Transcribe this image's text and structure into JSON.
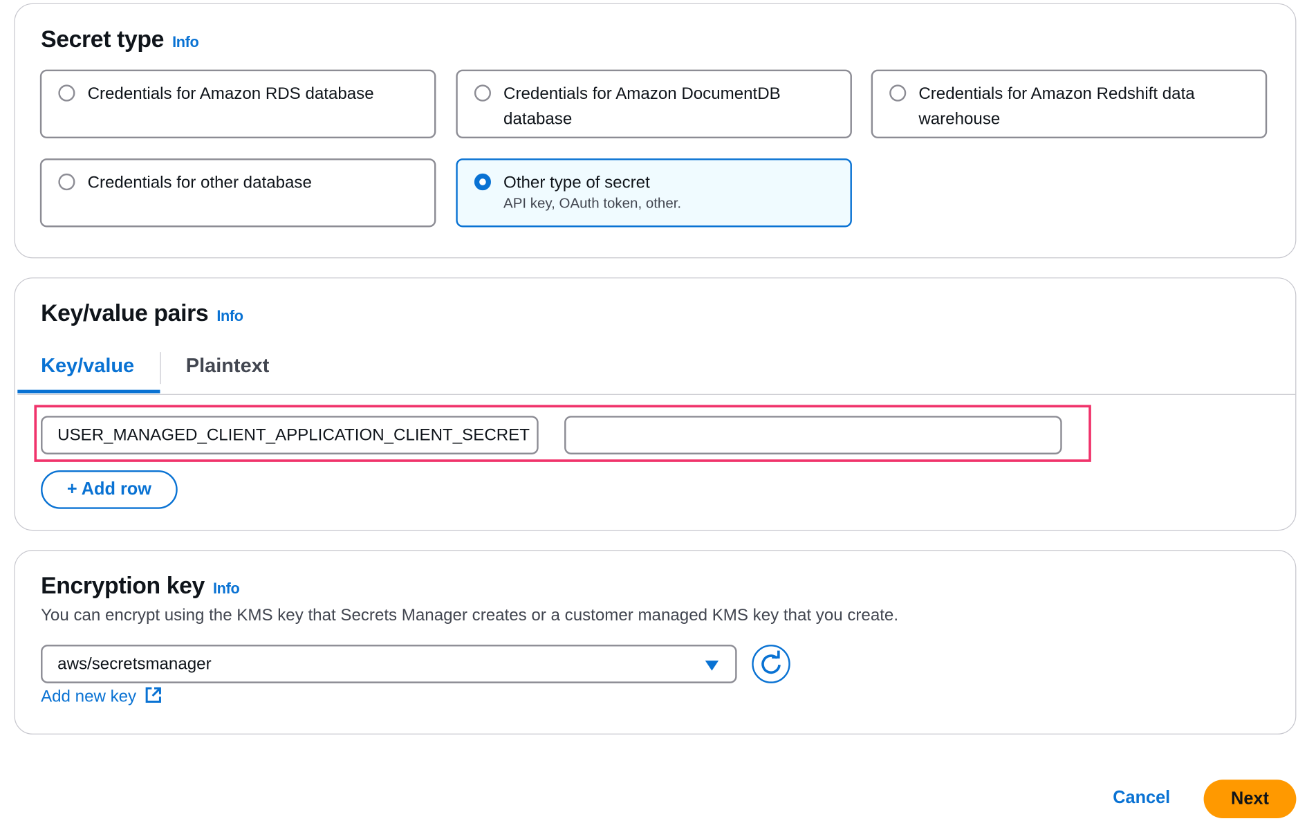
{
  "secret_type": {
    "title": "Secret type",
    "info": "Info",
    "options": [
      {
        "label": "Credentials for Amazon RDS database",
        "selected": false
      },
      {
        "label": "Credentials for Amazon DocumentDB database",
        "selected": false
      },
      {
        "label": "Credentials for Amazon Redshift data warehouse",
        "selected": false
      },
      {
        "label": "Credentials for other database",
        "selected": false
      },
      {
        "label": "Other type of secret",
        "description": "API key, OAuth token, other.",
        "selected": true
      }
    ]
  },
  "kv": {
    "title": "Key/value pairs",
    "info": "Info",
    "tabs": [
      {
        "label": "Key/value",
        "active": true
      },
      {
        "label": "Plaintext",
        "active": false
      }
    ],
    "rows": [
      {
        "key": "USER_MANAGED_CLIENT_APPLICATION_CLIENT_SECRET",
        "value": ""
      }
    ],
    "add_row": "+ Add row",
    "highlight_color": "#f0336b"
  },
  "encryption": {
    "title": "Encryption key",
    "info": "Info",
    "description": "You can encrypt using the KMS key that Secrets Manager creates or a customer managed KMS key that you create.",
    "selected_key": "aws/secretsmanager",
    "add_new_key": "Add new key"
  },
  "footer": {
    "cancel": "Cancel",
    "next": "Next"
  },
  "colors": {
    "accent": "#0972d3",
    "primary_button": "#ff9900"
  }
}
